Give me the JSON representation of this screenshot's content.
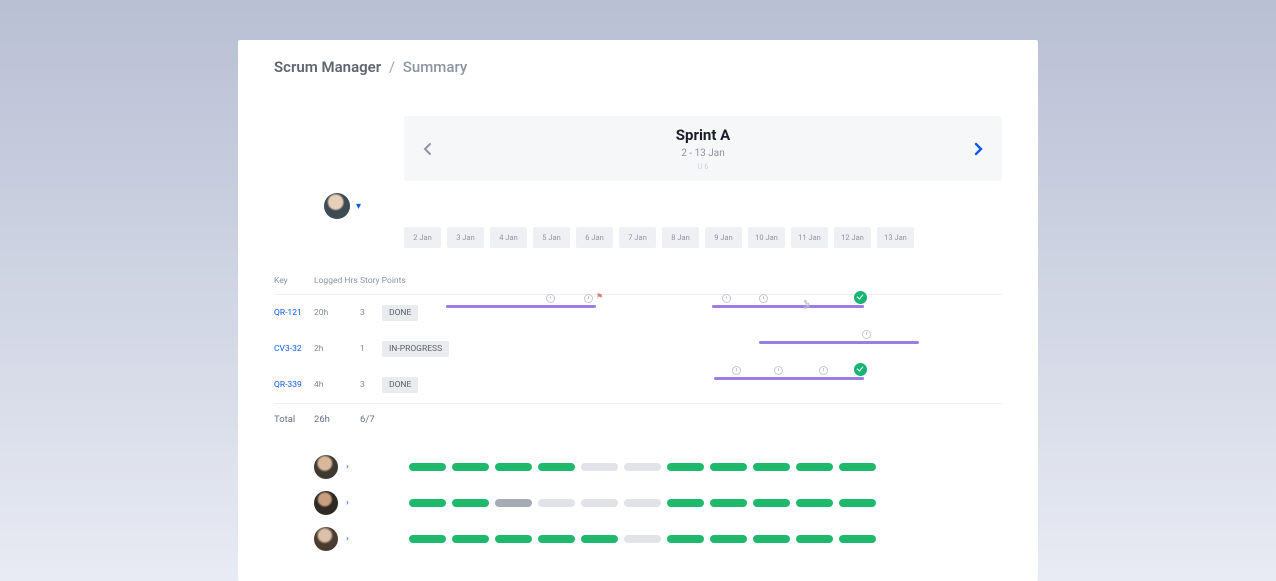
{
  "breadcrumb": {
    "app": "Scrum Manager",
    "page": "Summary"
  },
  "sprint": {
    "name": "Sprint A",
    "dates": "2 - 13 Jan",
    "default_label": "U 6"
  },
  "dates": [
    "2 Jan",
    "3 Jan",
    "4 Jan",
    "5 Jan",
    "6 Jan",
    "7 Jan",
    "8 Jan",
    "9 Jan",
    "10 Jan",
    "11 Jan",
    "12 Jan",
    "13 Jan"
  ],
  "columns": {
    "key": "Key",
    "hrs": "Logged Hrs",
    "sp": "Story Points"
  },
  "tasks": [
    {
      "key": "QR-121",
      "hrs": "20h",
      "sp": "3",
      "status": "DONE"
    },
    {
      "key": "CV3-32",
      "hrs": "2h",
      "sp": "1",
      "status": "IN-PROGRESS"
    },
    {
      "key": "QR-339",
      "hrs": "4h",
      "sp": "3",
      "status": "DONE"
    }
  ],
  "totals": {
    "label": "Total",
    "hrs": "26h",
    "sp": "6/7"
  },
  "users": [
    {
      "segments": [
        "g",
        "g",
        "g",
        "g",
        "n",
        "n",
        "g",
        "g",
        "g",
        "g",
        "g"
      ]
    },
    {
      "segments": [
        "g",
        "g",
        "d",
        "n",
        "n",
        "n",
        "g",
        "g",
        "g",
        "g",
        "g"
      ]
    },
    {
      "segments": [
        "g",
        "g",
        "g",
        "g",
        "g",
        "n",
        "g",
        "g",
        "g",
        "g",
        "g"
      ]
    }
  ],
  "colors": {
    "accent": "#0a5af5",
    "bar": "#9b7de6",
    "green": "#17b474"
  }
}
